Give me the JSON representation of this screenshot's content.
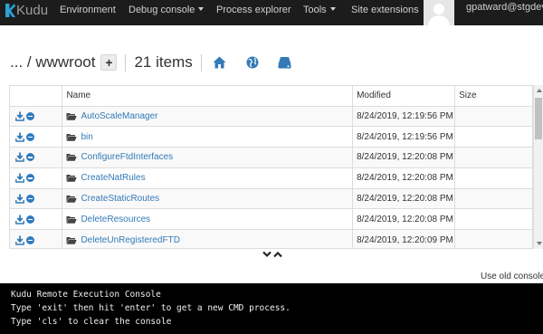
{
  "nav": {
    "brand": "Kudu",
    "items": [
      {
        "label": "Environment",
        "dropdown": false
      },
      {
        "label": "Debug console",
        "dropdown": true
      },
      {
        "label": "Process explorer",
        "dropdown": false
      },
      {
        "label": "Tools",
        "dropdown": true
      },
      {
        "label": "Site extensions",
        "dropdown": false
      }
    ],
    "user": "gpatward@stgdevit"
  },
  "pathbar": {
    "path": "... / wwwroot",
    "add_label": "+",
    "item_count": "21 items",
    "icons": [
      "home-icon",
      "globe-icon",
      "drive-icon"
    ]
  },
  "table": {
    "columns": [
      "Name",
      "Modified",
      "Size"
    ],
    "rows": [
      {
        "name": "AutoScaleManager",
        "modified": "8/24/2019, 12:19:56 PM",
        "size": ""
      },
      {
        "name": "bin",
        "modified": "8/24/2019, 12:19:56 PM",
        "size": ""
      },
      {
        "name": "ConfigureFtdInterfaces",
        "modified": "8/24/2019, 12:20:08 PM",
        "size": ""
      },
      {
        "name": "CreateNatRules",
        "modified": "8/24/2019, 12:20:08 PM",
        "size": ""
      },
      {
        "name": "CreateStaticRoutes",
        "modified": "8/24/2019, 12:20:08 PM",
        "size": ""
      },
      {
        "name": "DeleteResources",
        "modified": "8/24/2019, 12:20:08 PM",
        "size": ""
      },
      {
        "name": "DeleteUnRegisteredFTD",
        "modified": "8/24/2019, 12:20:09 PM",
        "size": ""
      }
    ]
  },
  "console": {
    "old_console_label": "Use old console",
    "lines": [
      "Kudu Remote Execution Console",
      "Type 'exit' then hit 'enter' to get a new CMD process.",
      "Type 'cls' to clear the console"
    ]
  },
  "colors": {
    "accent": "#337ab7",
    "navbar": "#1c1c1c",
    "console_bg": "#000000"
  }
}
